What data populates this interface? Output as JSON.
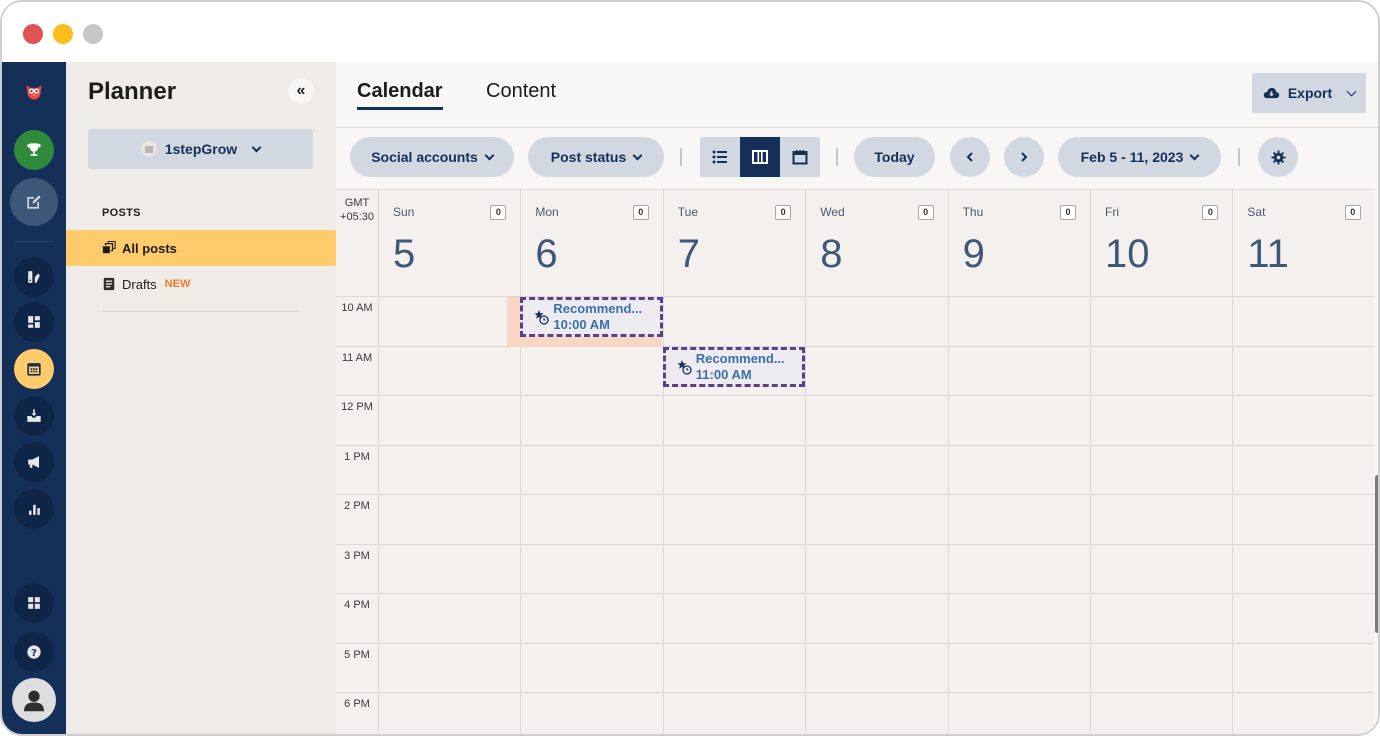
{
  "window": {
    "controls": [
      "close",
      "minimize",
      "zoom"
    ]
  },
  "rail": {
    "items": [
      {
        "icon": "owl-logo-icon",
        "label": "Hootsuite"
      },
      {
        "icon": "trophy-icon",
        "label": "Achievements"
      },
      {
        "icon": "compose-icon",
        "label": "Create"
      },
      {
        "icon": "brand-icon",
        "label": "Brand"
      },
      {
        "icon": "dashboard-icon",
        "label": "Streams"
      },
      {
        "icon": "calendar-icon",
        "label": "Planner",
        "active": true
      },
      {
        "icon": "inbox-icon",
        "label": "Inbox"
      },
      {
        "icon": "megaphone-icon",
        "label": "Advertise"
      },
      {
        "icon": "analytics-icon",
        "label": "Analytics"
      },
      {
        "icon": "apps-icon",
        "label": "Apps"
      },
      {
        "icon": "help-icon",
        "label": "Help"
      },
      {
        "icon": "profile-icon",
        "label": "Profile"
      }
    ]
  },
  "planner": {
    "title": "Planner",
    "collapse_icon": "«",
    "org": {
      "name": "1stepGrow"
    },
    "posts_heading": "POSTS",
    "items": [
      {
        "label": "All posts",
        "active": true,
        "icon": "stack-icon"
      },
      {
        "label": "Drafts",
        "badge": "NEW",
        "icon": "document-icon"
      }
    ]
  },
  "main": {
    "tabs": [
      {
        "label": "Calendar",
        "active": true
      },
      {
        "label": "Content",
        "active": false
      }
    ],
    "export_label": "Export",
    "toolbar": {
      "social_accounts": "Social accounts",
      "post_status": "Post status",
      "views": [
        "list",
        "week",
        "month"
      ],
      "active_view": "week",
      "today": "Today",
      "date_range": "Feb 5 - 11, 2023"
    },
    "calendar": {
      "timezone_line1": "GMT",
      "timezone_line2": "+05:30",
      "days": [
        {
          "name": "Sun",
          "num": "5",
          "count": "0"
        },
        {
          "name": "Mon",
          "num": "6",
          "count": "0"
        },
        {
          "name": "Tue",
          "num": "7",
          "count": "0"
        },
        {
          "name": "Wed",
          "num": "8",
          "count": "0"
        },
        {
          "name": "Thu",
          "num": "9",
          "count": "0"
        },
        {
          "name": "Fri",
          "num": "10",
          "count": "0"
        },
        {
          "name": "Sat",
          "num": "11",
          "count": "0"
        }
      ],
      "hours": [
        "10 AM",
        "11 AM",
        "12 PM",
        "1 PM",
        "2 PM",
        "3 PM",
        "4 PM",
        "5 PM",
        "6 PM"
      ],
      "events": [
        {
          "title": "Recommend...",
          "time": "10:00 AM",
          "day": "Mon",
          "highlighted": true
        },
        {
          "title": "Recommend...",
          "time": "11:00 AM",
          "day": "Tue",
          "highlighted": false
        }
      ]
    }
  },
  "colors": {
    "rail_bg": "#143059",
    "accent_yellow": "#ffcb6b",
    "pill_bg": "#d2d8e1",
    "brand_navy": "#143059",
    "event_border": "#5a3f8a",
    "new_badge": "#f4792b"
  }
}
